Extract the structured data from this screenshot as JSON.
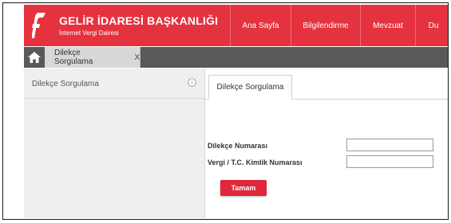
{
  "header": {
    "title": "GELİR İDARESİ BAŞKANLIĞI",
    "subtitle": "İnternet Vergi Dairesi",
    "logo_icon": "gib-logo-icon",
    "background_color": "#e5323f",
    "nav": [
      {
        "label": "Ana Sayfa"
      },
      {
        "label": "Bilgilendirme"
      },
      {
        "label": "Mevzuat"
      },
      {
        "label": "Du"
      }
    ]
  },
  "tabbar": {
    "home_icon": "home-icon",
    "open_tab": {
      "label": "Dilekçe Sorgulama",
      "close_label": "X"
    }
  },
  "sidebar": {
    "title": "Dilekçe Sorgulama",
    "collapse_icon": "collapse-arrow-icon"
  },
  "main": {
    "tab_label": "Dilekçe Sorgulama",
    "fields": [
      {
        "label": "Dilekçe Numarası",
        "value": ""
      },
      {
        "label": "Vergi / T.C. Kimlik Numarası",
        "value": ""
      }
    ],
    "submit_label": "Tamam",
    "submit_color": "#e0263a"
  }
}
